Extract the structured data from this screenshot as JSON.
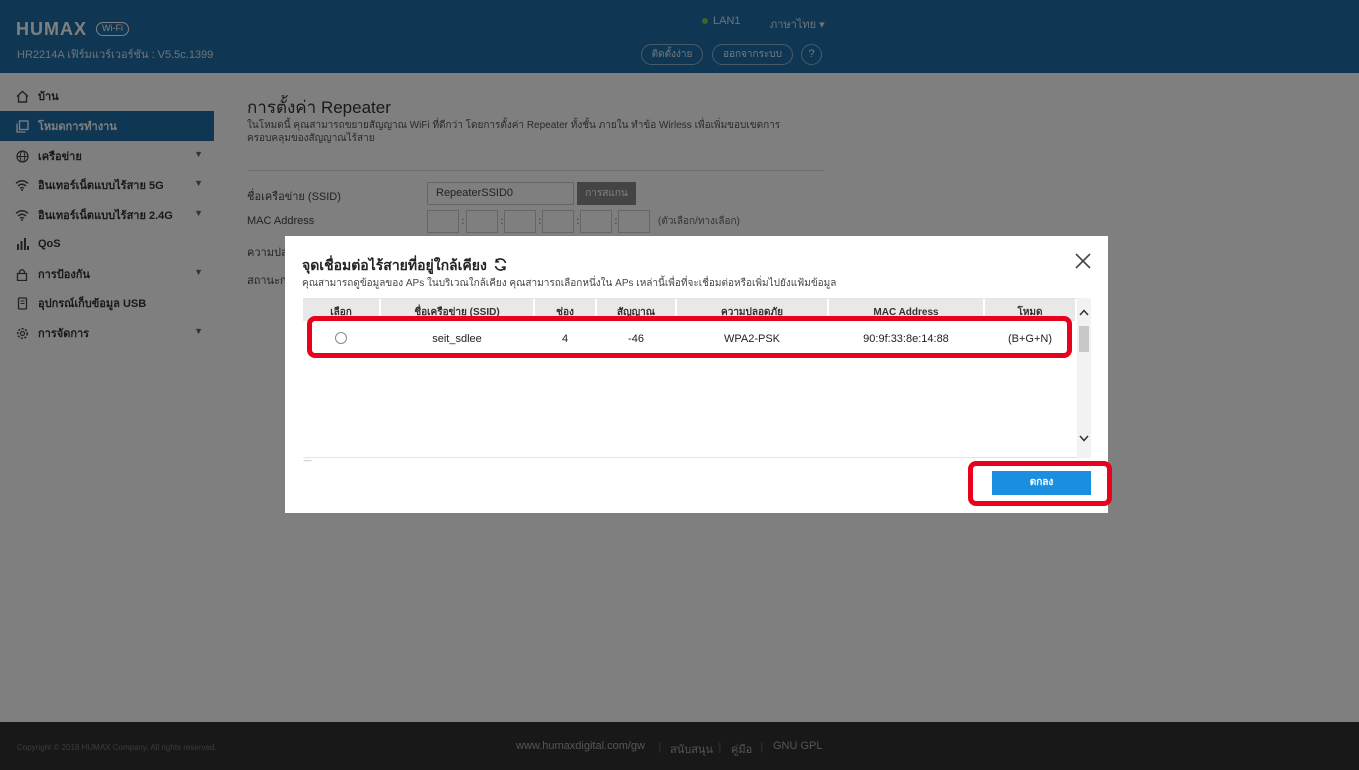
{
  "header": {
    "logo": "HUMAX",
    "logo_badge": "Wi-Fi",
    "model": "HR2214A เฟิร์มแวร์เวอร์ชัน : V5.5c.1399",
    "lan_status": "LAN1",
    "language": "ภาษาไทย",
    "setup_btn": "ติดตั้งง่าย",
    "logout_btn": "ออกจากระบบ",
    "help_btn": "?"
  },
  "sidebar": {
    "items": [
      {
        "label": "บ้าน",
        "icon": "home-icon"
      },
      {
        "label": "โหมดการทำงาน",
        "icon": "copy-icon",
        "active": true
      },
      {
        "label": "เครือข่าย",
        "icon": "globe-icon"
      },
      {
        "label": "อินเทอร์เน็ตแบบไร้สาย 5G",
        "icon": "wifi-icon"
      },
      {
        "label": "อินเทอร์เน็ตแบบไร้สาย 2.4G",
        "icon": "wifi-icon"
      },
      {
        "label": "QoS",
        "icon": "bars-icon"
      },
      {
        "label": "การป้องกัน",
        "icon": "lock-icon"
      },
      {
        "label": "อุปกรณ์เก็บข้อมูล USB",
        "icon": "usb-icon"
      },
      {
        "label": "การจัดการ",
        "icon": "gear-icon"
      }
    ]
  },
  "page": {
    "title": "การตั้งค่า Repeater",
    "description": "ในโหมดนี้ คุณสามารถขยายสัญญาณ WiFi ที่ดีกว่า โดยการตั้งค่า Repeater ทั้งชั้น ภายใน ทำข้อ Wirless เพื่อเพิ่มขอบเขตการครอบคลุมของสัญญาณไร้สาย",
    "ssid_label": "ชื่อเครือข่าย (SSID)",
    "ssid_value": "RepeaterSSID0",
    "scan_btn": "การสแกน",
    "mac_label": "MAC Address",
    "mac_hint": "(ตัวเลือก/ทางเลือก)",
    "security_label": "ความปลอ",
    "status_label": "สถานะการ"
  },
  "modal": {
    "title": "จุดเชื่อมต่อไร้สายที่อยู่ใกล้เคียง",
    "description": "คุณสามารถดูข้อมูลของ APs ในบริเวณใกล้เคียง คุณสามารถเลือกหนึ่งใน APs เหล่านี้เพื่อที่จะเชื่อมต่อหรือเพิ่มไปยังแฟ้มข้อมูล",
    "columns": [
      "เลือก",
      "ชื่อเครือข่าย (SSID)",
      "ช่อง",
      "สัญญาณ",
      "ความปลอดภัย",
      "MAC Address",
      "โหมด"
    ],
    "rows": [
      {
        "ssid": "seit_sdlee",
        "channel": "4",
        "signal": "-46",
        "security": "WPA2-PSK",
        "mac": "90:9f:33:8e:14:88",
        "mode": "(B+G+N)"
      }
    ],
    "dash": "—",
    "ok_btn": "ตกลง"
  },
  "footer": {
    "copyright": "Copyright © 2018 HUMAX Company. All rights reserved.",
    "website": "www.humaxdigital.com/gw",
    "support": "สนับสนุน",
    "manual": "คู่มือ",
    "gpl": "GNU GPL"
  },
  "colors": {
    "header_bg": "#1f6fa8",
    "accent": "#1a8fe0",
    "highlight": "#e8001c"
  }
}
